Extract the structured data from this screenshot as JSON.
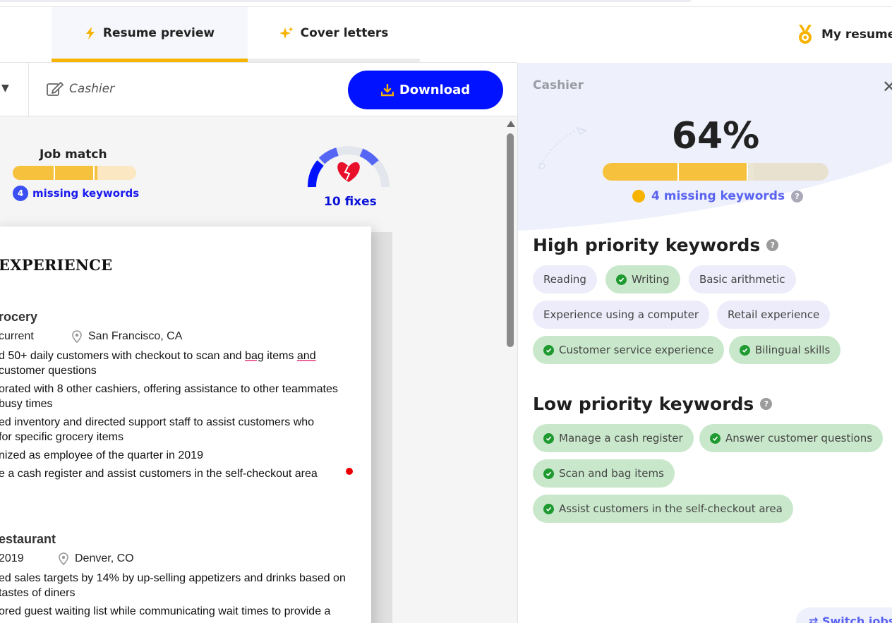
{
  "tabs": {
    "resume_preview": "Resume preview",
    "cover_letters": "Cover letters",
    "my_resume": "My resume"
  },
  "toolbar": {
    "job_title": "Cashier",
    "download_label": "Download"
  },
  "job_match": {
    "label": "Job match",
    "missing_count": "4",
    "missing_label": "missing keywords",
    "fixes_label": "10 fixes",
    "progress_fraction": 0.64
  },
  "resume": {
    "section_heading": "EXPERIENCE",
    "jobs": [
      {
        "company": "rocery",
        "dates": "current",
        "location": "San Francisco, CA",
        "bullets": [
          [
            "d 50+ daily customers with checkout to scan and ",
            "bag",
            " items ",
            "and"
          ],
          [
            "",
            "",
            " customer questions"
          ],
          "orated with 8 other cashiers, offering assistance to other teammates",
          " busy times",
          "ed inventory and directed support staff to assist customers who",
          "for specific grocery items",
          "nized as employee of the quarter in 2019",
          "e a cash register and assist customers in the self-checkout area"
        ]
      },
      {
        "company": "estaurant",
        "dates": "2019",
        "location": "Denver, CO",
        "bullets": [
          "ed sales targets by 14% by up-selling appetizers and drinks based on",
          " tastes of diners",
          "ored guest waiting list while communicating wait times to provide a"
        ]
      }
    ]
  },
  "keywords_panel": {
    "job_name": "Cashier",
    "match_percent": "64%",
    "progress_fraction": 0.64,
    "missing_label": "4 missing keywords",
    "high_title": "High priority keywords",
    "high": [
      {
        "label": "Reading",
        "matched": false
      },
      {
        "label": "Writing",
        "matched": true
      },
      {
        "label": "Basic arithmetic",
        "matched": false
      },
      {
        "label": "Experience using a computer",
        "matched": false
      },
      {
        "label": "Retail experience",
        "matched": false
      },
      {
        "label": "Customer service experience",
        "matched": true
      },
      {
        "label": "Bilingual skills",
        "matched": true
      }
    ],
    "low_title": "Low priority keywords",
    "low": [
      {
        "label": "Manage a cash register",
        "matched": true
      },
      {
        "label": "Answer customer questions",
        "matched": true
      },
      {
        "label": "Scan and bag items",
        "matched": true
      },
      {
        "label": "Assist customers in the self-checkout area",
        "matched": true
      }
    ],
    "switch_label": "⇄ Switch jobs"
  },
  "colors": {
    "accent_blue": "#0012ff",
    "progress_yellow": "#f6c23e",
    "matched_green": "#c9e8cb",
    "missing_lavender": "#ececfa"
  }
}
